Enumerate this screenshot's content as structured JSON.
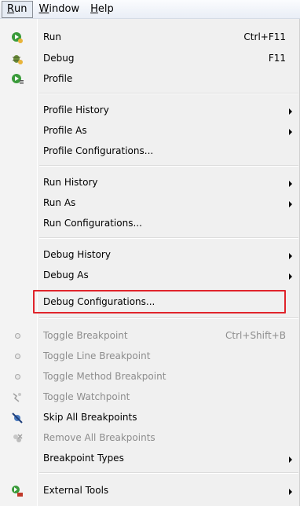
{
  "menubar": {
    "items": [
      {
        "label": "Run",
        "mnemonic": "R",
        "rest": "un"
      },
      {
        "label": "Window",
        "mnemonic": "W",
        "rest": "indow"
      },
      {
        "label": "Help",
        "mnemonic": "H",
        "rest": "elp"
      }
    ]
  },
  "menu": {
    "run": {
      "label": "Run",
      "accel": "Ctrl+F11",
      "icon": "run-icon"
    },
    "debug": {
      "label": "Debug",
      "accel": "F11",
      "icon": "debug-icon"
    },
    "profile": {
      "label": "Profile",
      "icon": "profile-icon"
    },
    "profile_history": {
      "label": "Profile History"
    },
    "profile_as": {
      "label": "Profile As"
    },
    "profile_configurations": {
      "label": "Profile Configurations..."
    },
    "run_history": {
      "label": "Run History"
    },
    "run_as": {
      "label": "Run As"
    },
    "run_configurations": {
      "label": "Run Configurations..."
    },
    "debug_history": {
      "label": "Debug History"
    },
    "debug_as": {
      "label": "Debug As"
    },
    "debug_configurations": {
      "label": "Debug Configurations..."
    },
    "toggle_breakpoint": {
      "label": "Toggle Breakpoint",
      "accel": "Ctrl+Shift+B"
    },
    "toggle_line_breakpoint": {
      "label": "Toggle Line Breakpoint"
    },
    "toggle_method_breakpoint": {
      "label": "Toggle Method Breakpoint"
    },
    "toggle_watchpoint": {
      "label": "Toggle Watchpoint"
    },
    "skip_all_breakpoints": {
      "label": "Skip All Breakpoints"
    },
    "remove_all_breakpoints": {
      "label": "Remove All Breakpoints"
    },
    "breakpoint_types": {
      "label": "Breakpoint Types"
    },
    "external_tools": {
      "label": "External Tools"
    }
  },
  "colors": {
    "highlight_border": "#e0242b",
    "disabled_text": "#8d8d8d",
    "run_green": "#3a9b3a"
  }
}
